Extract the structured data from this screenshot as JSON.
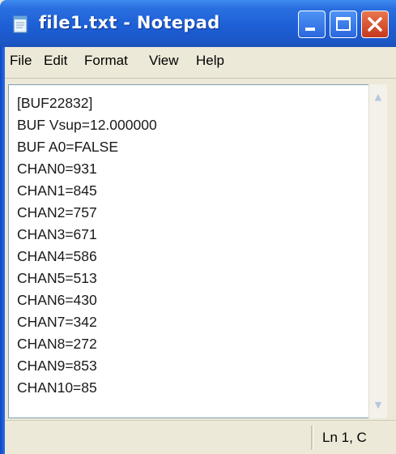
{
  "window": {
    "title": "file1.txt - Notepad"
  },
  "menu": {
    "items": [
      "File",
      "Edit",
      "Format",
      "View",
      "Help"
    ]
  },
  "document": {
    "lines": [
      "[BUF22832]",
      "BUF Vsup=12.000000",
      "BUF A0=FALSE",
      "CHAN0=931",
      "CHAN1=845",
      "CHAN2=757",
      "CHAN3=671",
      "CHAN4=586",
      "CHAN5=513",
      "CHAN6=430",
      "CHAN7=342",
      "CHAN8=272",
      "CHAN9=853",
      "CHAN10=85"
    ]
  },
  "status": {
    "position": "Ln 1, C"
  },
  "icons": {
    "app": "notepad-icon",
    "minimize": "minimize-icon",
    "maximize": "maximize-icon",
    "close": "close-icon"
  },
  "colors": {
    "titlebar": "#1d5fd6",
    "close_button": "#c5381c",
    "chrome": "#ece9d8"
  }
}
